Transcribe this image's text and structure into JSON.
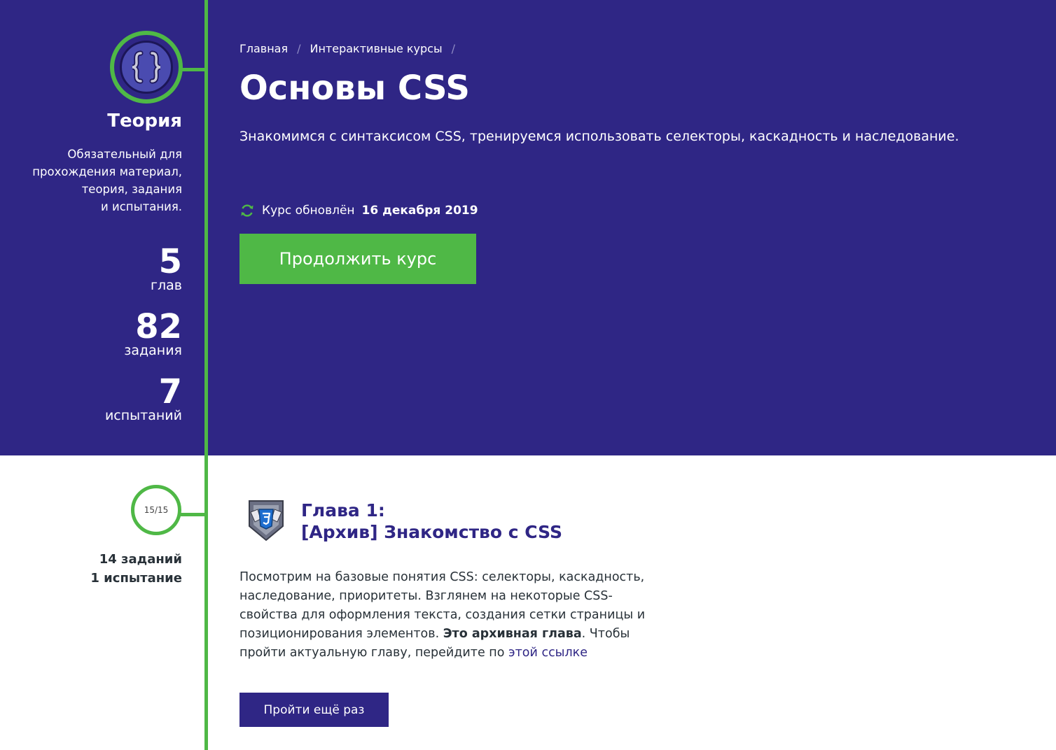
{
  "sidebar": {
    "theory_title": "Теория",
    "theory_desc_lines": [
      "Обязательный для",
      "прохождения материал,",
      "теория, задания",
      "и испытания."
    ],
    "stats": [
      {
        "value": "5",
        "label": "глав"
      },
      {
        "value": "82",
        "label": "задания"
      },
      {
        "value": "7",
        "label": "испытаний"
      }
    ]
  },
  "breadcrumb": {
    "items": [
      "Главная",
      "Интерактивные курсы"
    ],
    "separator": "/"
  },
  "course": {
    "title": "Основы CSS",
    "description": "Знакомимся с синтаксисом CSS, тренируемся использовать селекторы, каскадность и наследование.",
    "updated_prefix": "Курс обновлён",
    "updated_date": "16 декабря 2019",
    "continue_label": "Продолжить курс"
  },
  "chapter": {
    "progress": "15/15",
    "progress_value": 1.0,
    "tasks_count": "14 заданий",
    "trials_count": "1 испытание",
    "title_line1": "Глава 1:",
    "title_line2": "[Архив] Знакомство с CSS",
    "desc_part1": "Посмотрим на базовые понятия CSS: селекторы, каскадность, наследование, приоритеты. Взглянем на некоторые CSS-свойства для оформления текста, создания сетки страницы и позиционирования элементов.",
    "desc_bold": "Это архивная глава",
    "desc_part2": ". Чтобы пройти актуальную главу, перейдите по",
    "desc_link": "этой ссылке",
    "again_label": "Пройти ещё раз"
  },
  "colors": {
    "hero_bg": "#2f2685",
    "accent_green": "#4fb846",
    "text_dark": "#283138"
  },
  "icons": [
    "curly-braces-icon",
    "refresh-icon",
    "css3-shield-badge-icon"
  ]
}
